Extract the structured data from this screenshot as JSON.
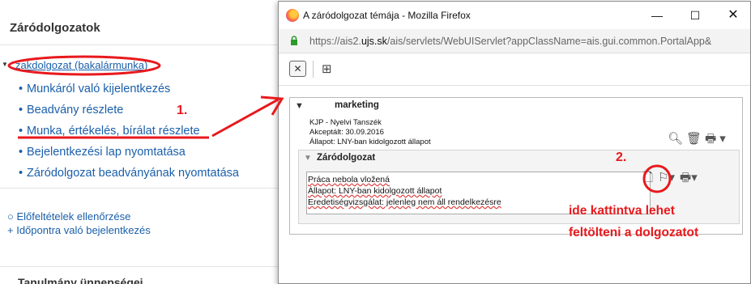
{
  "background_page": {
    "section_title": "Záródolgozatok",
    "tree_root_label": "zakdolgozat (bakalármunka)",
    "menu_items": [
      "Munkáról való kijelentkezés",
      "Beadvány részlete",
      "Munka, értékelés, bírálat részlete",
      "Bejelentkezési lap nyomtatása",
      "Záródolgozat beadványának nyomtatása"
    ],
    "sub_links": [
      "○ Előfeltételek ellenőrzése",
      "+ Időpontra való bejelentkezés"
    ],
    "bottom_heading": "Tanulmány ünnepségei"
  },
  "browser": {
    "window_title": "A záródolgozat témája - Mozilla Firefox",
    "url_prefix": "https://ais2.",
    "url_host": "ujs.sk",
    "url_rest": "/ais/servlets/WebUIServlet?appClassName=ais.gui.common.PortalApp&"
  },
  "panel": {
    "title": "marketing",
    "info_lines": [
      "KJP - Nyelvi Tanszék",
      "Akceptált: 30.09.2016",
      "Állapot: LNY-ban kidolgozott állapot"
    ],
    "sub_title": "Záródolgozat",
    "doc_lines": [
      "Práca nebola vložená",
      "Állapot: LNY-ban kidolgozott állapot",
      "Eredetiségvizsgálat: jelenleg nem áll rendelkezésre"
    ]
  },
  "annotations": {
    "step1": "1.",
    "step2": "2.",
    "hint_line1": "ide kattintva lehet",
    "hint_line2": "feltölteni a dolgozatot",
    "color": "#e8191d"
  },
  "icons": [
    "firefox-logo",
    "lock-icon",
    "close-icon",
    "tree-icon",
    "zoom-icon",
    "trash-icon",
    "printer-icon",
    "upload-file-icon",
    "person-icon"
  ]
}
